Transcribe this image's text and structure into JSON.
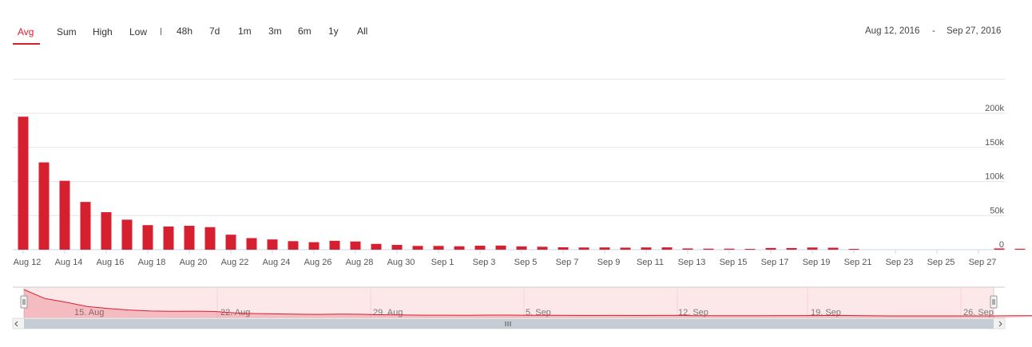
{
  "toolbar": {
    "modes": [
      "Avg",
      "Sum",
      "High",
      "Low"
    ],
    "active_mode": "Avg",
    "zoom": [
      "48h",
      "7d",
      "1m",
      "3m",
      "6m",
      "1y",
      "All"
    ],
    "range_start": "Aug 12, 2016",
    "range_sep": "-",
    "range_end": "Sep 27, 2016"
  },
  "colors": {
    "accent": "#d6202f",
    "navigator_fill": "#fde8e9",
    "scrollbar": "#c6ccd4"
  },
  "chart_data": {
    "type": "bar",
    "x_start": "2016-08-12",
    "x_end": "2016-09-27",
    "xticks": [
      "Aug 12",
      "Aug 14",
      "Aug 16",
      "Aug 18",
      "Aug 20",
      "Aug 22",
      "Aug 24",
      "Aug 26",
      "Aug 28",
      "Aug 30",
      "Sep 1",
      "Sep 3",
      "Sep 5",
      "Sep 7",
      "Sep 9",
      "Sep 11",
      "Sep 13",
      "Sep 15",
      "Sep 17",
      "Sep 19",
      "Sep 21",
      "Sep 23",
      "Sep 25",
      "Sep 27"
    ],
    "yticks": [
      "0",
      "50k",
      "100k",
      "150k",
      "200k"
    ],
    "ylim": [
      0,
      250000
    ],
    "grid": true,
    "values": [
      195000,
      128000,
      101000,
      70000,
      55000,
      44000,
      36000,
      34000,
      35000,
      33000,
      22000,
      17000,
      15000,
      12500,
      11000,
      13000,
      12000,
      8500,
      7000,
      5500,
      5500,
      5000,
      5800,
      6000,
      4800,
      4300,
      3500,
      3200,
      3300,
      3000,
      3300,
      3400,
      1800,
      1500,
      1500,
      1200,
      2500,
      2400,
      3200,
      2900,
      1200,
      0,
      0,
      0,
      0,
      0,
      0,
      1800,
      1400,
      0
    ],
    "navigator": {
      "labels": [
        "15. Aug",
        "22. Aug",
        "29. Aug",
        "5. Sep",
        "12. Sep",
        "19. Sep",
        "26. Sep"
      ]
    }
  }
}
